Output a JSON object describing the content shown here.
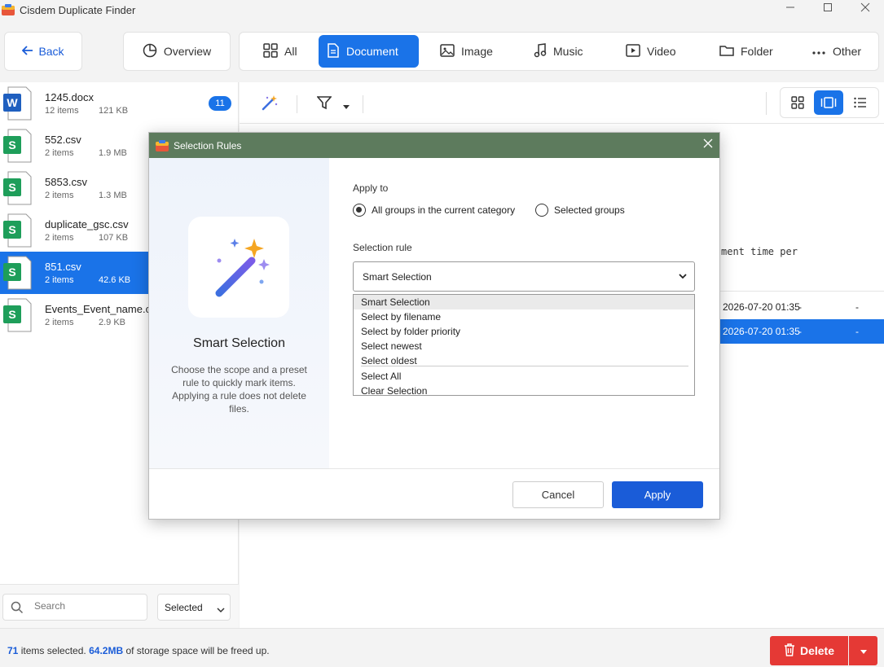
{
  "window": {
    "title": "Cisdem Duplicate Finder",
    "controls": [
      "minimize-icon",
      "maximize-icon",
      "close-icon"
    ]
  },
  "nav": {
    "back_label": "Back",
    "overview_label": "Overview",
    "tabs": [
      {
        "label": "All",
        "icon": "grid-icon",
        "active": false
      },
      {
        "label": "Document",
        "icon": "document-icon",
        "active": true
      },
      {
        "label": "Image",
        "icon": "image-icon",
        "active": false
      },
      {
        "label": "Music",
        "icon": "music-icon",
        "active": false
      },
      {
        "label": "Video",
        "icon": "video-icon",
        "active": false
      },
      {
        "label": "Folder",
        "icon": "folder-icon",
        "active": false
      },
      {
        "label": "Other",
        "icon": "more-icon",
        "active": false
      }
    ]
  },
  "file_list": [
    {
      "name": "1245.docx",
      "count": "12 items",
      "size": "121 KB",
      "type": "word",
      "badge": "11",
      "selected": false
    },
    {
      "name": "552.csv",
      "count": "2 items",
      "size": "1.9 MB",
      "type": "sheet",
      "selected": false
    },
    {
      "name": "5853.csv",
      "count": "2 items",
      "size": "1.3 MB",
      "type": "sheet",
      "selected": false
    },
    {
      "name": "duplicate_gsc.csv",
      "count": "2 items",
      "size": "107 KB",
      "type": "sheet",
      "selected": false
    },
    {
      "name": "851.csv",
      "count": "2 items",
      "size": "42.6 KB",
      "type": "sheet",
      "selected": true
    },
    {
      "name": "Events_Event_name.csv",
      "count": "2 items",
      "size": "2.9 KB",
      "type": "sheet",
      "selected": false
    }
  ],
  "search": {
    "placeholder": "Search",
    "filter_value": "Selected"
  },
  "background_content": {
    "partial_text": "ment time per",
    "rows": [
      {
        "date": "2026-07-20 01:35",
        "col2": "-",
        "col3": "-",
        "selected": false
      },
      {
        "date": "2026-07-20 01:35",
        "col2": "-",
        "col3": "-",
        "selected": true
      }
    ]
  },
  "status": {
    "count": "71",
    "count_suffix": "items selected.",
    "size": "64.2MB",
    "size_suffix": "of storage space will be freed up.",
    "delete_label": "Delete"
  },
  "dialog": {
    "title": "Selection Rules",
    "panel_title": "Smart Selection",
    "panel_desc": "Choose the scope and a preset rule to quickly mark items. Applying a rule does not delete files.",
    "apply_to_label": "Apply to",
    "radio_all": "All groups in the current category",
    "radio_selected": "Selected groups",
    "radio_all_checked": true,
    "rule_label": "Selection rule",
    "rule_value": "Smart Selection",
    "rule_options": [
      "Smart Selection",
      "Select by filename",
      "Select by folder priority",
      "Select newest",
      "Select oldest",
      "Select All",
      "Clear Selection"
    ],
    "cancel_label": "Cancel",
    "apply_label": "Apply"
  },
  "colors": {
    "accent": "#1a73e8",
    "dialog_title_bar": "#5d7b5d",
    "delete": "#e53935",
    "apply": "#1a5cd8"
  }
}
